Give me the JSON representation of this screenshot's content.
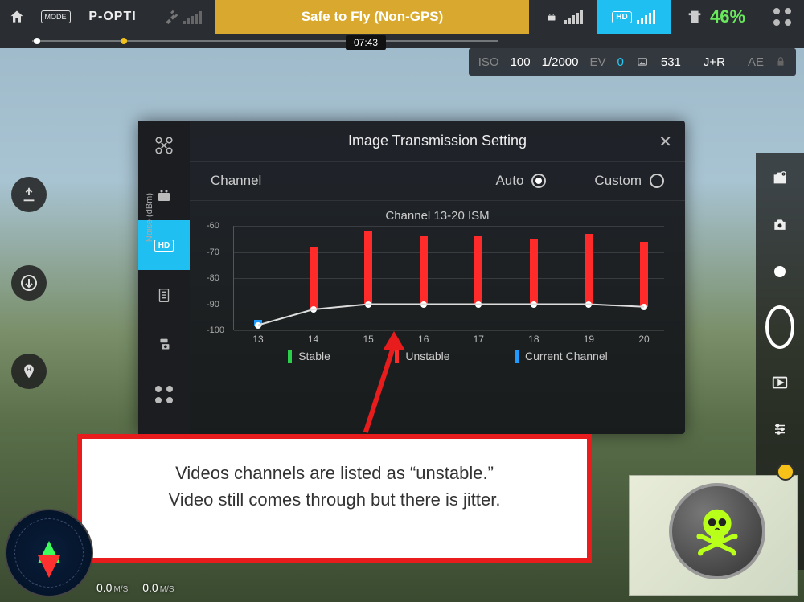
{
  "topbar": {
    "mode_badge": "MODE",
    "flight_mode": "P-OPTI",
    "status": "Safe to Fly (Non-GPS)",
    "hd_label": "HD",
    "battery_pct": "46%"
  },
  "timeline": {
    "elapsed": "07:43"
  },
  "camera_bar": {
    "iso_label": "ISO",
    "iso": "100",
    "shutter": "1/2000",
    "ev_label": "EV",
    "ev": "0",
    "shots": "531",
    "format": "J+R",
    "ae_label": "AE"
  },
  "modal": {
    "title": "Image Transmission Setting",
    "channel_label": "Channel",
    "auto_label": "Auto",
    "custom_label": "Custom",
    "auto_selected": true
  },
  "legend": {
    "stable": "Stable",
    "unstable": "Unstable",
    "current": "Current Channel"
  },
  "chart_data": {
    "type": "bar",
    "title": "Channel 13-20 ISM",
    "ylabel": "Noise (dBm)",
    "ylim": [
      -100,
      -60
    ],
    "yticks": [
      -60,
      -70,
      -80,
      -90,
      -100
    ],
    "categories": [
      "13",
      "14",
      "15",
      "16",
      "17",
      "18",
      "19",
      "20"
    ],
    "series": [
      {
        "name": "noise_level",
        "values": [
          -98,
          -92,
          -90,
          -90,
          -90,
          -90,
          -90,
          -91
        ]
      },
      {
        "name": "bar_top_dbm",
        "values": [
          -96,
          -68,
          -62,
          -64,
          -64,
          -65,
          -63,
          -66
        ]
      }
    ],
    "status": [
      "current",
      "unstable",
      "unstable",
      "unstable",
      "unstable",
      "unstable",
      "unstable",
      "unstable"
    ],
    "colors": {
      "stable": "#2bcf4a",
      "unstable": "#ff2a2a",
      "current": "#1f9bff"
    }
  },
  "annotation": {
    "line1": "Videos channels are listed as “unstable.”",
    "line2": "Video still comes through but there is jitter."
  },
  "telemetry": {
    "hs": "0.0",
    "vs": "0.0",
    "unit": "M/S"
  }
}
